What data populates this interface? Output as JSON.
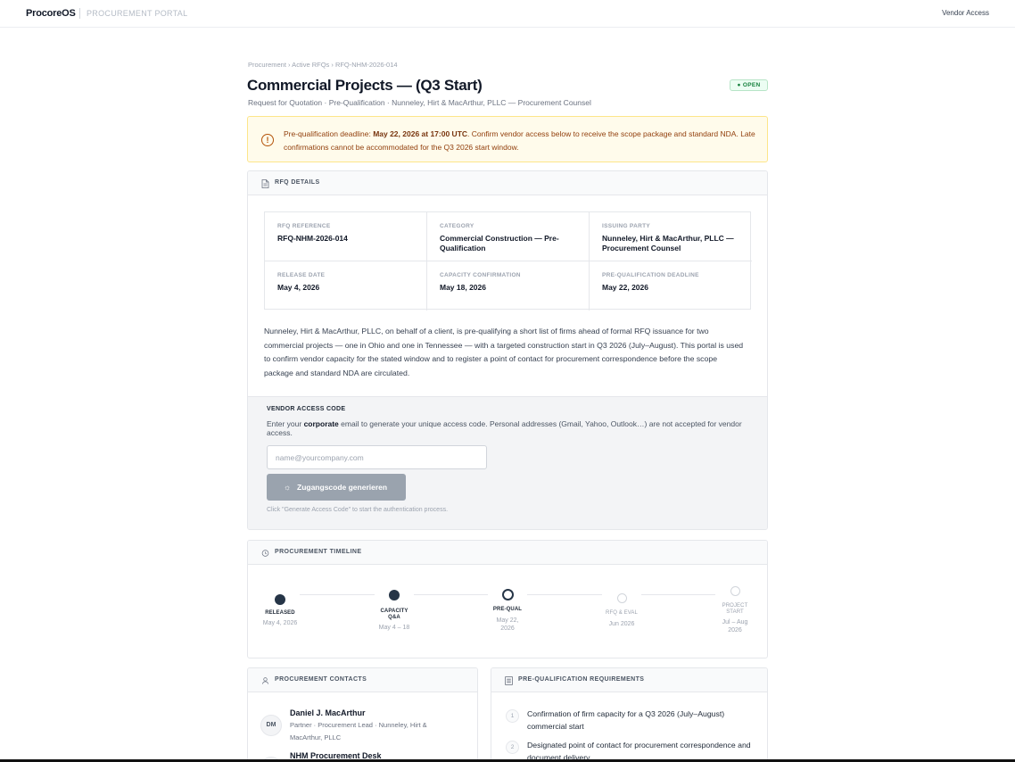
{
  "header": {
    "brand": "ProcoreOS",
    "portal_label": "PROCUREMENT PORTAL",
    "vendor_access": "Vendor Access"
  },
  "breadcrumb": "Procurement › Active RFQs › RFQ-NHM-2026-014",
  "page": {
    "title": "Commercial Projects — (Q3 Start)",
    "status": "● OPEN",
    "subtitle": "Request for Quotation · Pre-Qualification · Nunneley, Hirt & MacArthur, PLLC — Procurement Counsel"
  },
  "alert": {
    "icon": "exclamation-circle",
    "prefix": "Pre-qualification deadline: ",
    "deadline": "May 22, 2026 at 17:00 UTC",
    "suffix": ". Confirm vendor access below to receive the scope package and standard NDA. Late confirmations cannot be accommodated for the Q3 2026 start window."
  },
  "details": {
    "title": "RFQ DETAILS",
    "icon": "document-icon",
    "cells": [
      {
        "label": "RFQ REFERENCE",
        "value": "RFQ-NHM-2026-014"
      },
      {
        "label": "CATEGORY",
        "value": "Commercial Construction — Pre-Qualification"
      },
      {
        "label": "ISSUING PARTY",
        "value": "Nunneley, Hirt & MacArthur, PLLC — Procurement Counsel"
      },
      {
        "label": "RELEASE DATE",
        "value": "May 4, 2026"
      },
      {
        "label": "CAPACITY CONFIRMATION",
        "value": "May 18, 2026"
      },
      {
        "label": "PRE-QUALIFICATION DEADLINE",
        "value": "May 22, 2026"
      }
    ],
    "description": "Nunneley, Hirt & MacArthur, PLLC, on behalf of a client, is pre-qualifying a short list of firms ahead of formal RFQ issuance for two commercial projects — one in Ohio and one in Tennessee — with a targeted construction start in Q3 2026 (July–August). This portal is used to confirm vendor capacity for the stated window and to register a point of contact for procurement correspondence before the scope package and standard NDA are circulated."
  },
  "access": {
    "title": "VENDOR ACCESS CODE",
    "help_prefix": "Enter your ",
    "help_bold": "corporate",
    "help_suffix": " email to generate your unique access code. Personal addresses (Gmail, Yahoo, Outlook…) are not accepted for vendor access.",
    "email_placeholder": "name@yourcompany.com",
    "email_value": "",
    "button_icon": "☼",
    "button_label": "Zugangscode generieren",
    "hint": "Click \"Generate Access Code\" to start the authentication process."
  },
  "timeline": {
    "title": "PROCUREMENT TIMELINE",
    "icon": "clock-icon",
    "steps": [
      {
        "label": "RELEASED",
        "date": "May 4, 2026",
        "state": "done"
      },
      {
        "label": "CAPACITY Q&A",
        "date": "May 4 – 18",
        "state": "done"
      },
      {
        "label": "PRE-QUAL",
        "date": "May 22, 2026",
        "state": "current"
      },
      {
        "label": "RFQ & EVAL",
        "date": "Jun 2026",
        "state": "upcoming"
      },
      {
        "label": "PROJECT START",
        "date": "Jul – Aug 2026",
        "state": "upcoming"
      }
    ]
  },
  "contacts": {
    "title": "PROCUREMENT CONTACTS",
    "icon": "person-icon",
    "items": [
      {
        "initials": "DM",
        "name": "Daniel J. MacArthur",
        "role": "Partner · Procurement Lead · Nunneley, Hirt & MacArthur, PLLC"
      },
      {
        "initials": "",
        "name": "NHM Procurement Desk",
        "role": ""
      }
    ]
  },
  "requirements": {
    "title": "PRE-QUALIFICATION REQUIREMENTS",
    "icon": "list-icon",
    "items": [
      {
        "num": "1",
        "text": "Confirmation of firm capacity for a Q3 2026 (July–August) commercial start"
      },
      {
        "num": "2",
        "text": "Designated point of contact for procurement correspondence and document delivery"
      }
    ]
  },
  "colors": {
    "done": "#263547",
    "upcoming": "#d1d5db",
    "open_badge": "#15803d",
    "alert_bg": "#fffbeb"
  }
}
